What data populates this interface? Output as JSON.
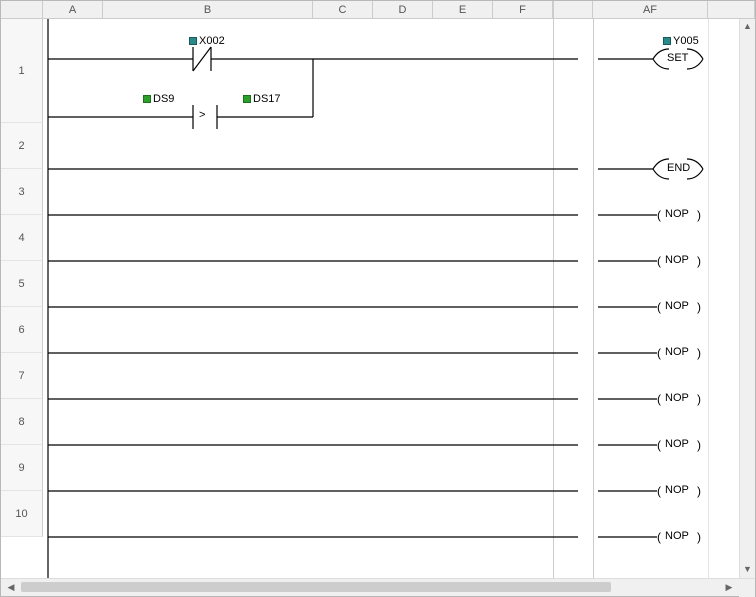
{
  "columns": {
    "A": "A",
    "B": "B",
    "C": "C",
    "D": "D",
    "E": "E",
    "F": "F",
    "AF": "AF"
  },
  "row_labels": [
    "1",
    "2",
    "3",
    "4",
    "5",
    "6",
    "7",
    "8",
    "9",
    "10"
  ],
  "rung1": {
    "contact1": "X002",
    "compare_left": "DS9",
    "compare_op": ">",
    "compare_right": "DS17",
    "output": "Y005",
    "coil": "SET"
  },
  "rung2": {
    "coil": "END"
  },
  "nop_label": "NOP",
  "chart_data": {
    "type": "table",
    "title": "Ladder Logic Program",
    "rungs": [
      {
        "rung": 1,
        "branches": [
          {
            "elements": [
              {
                "type": "contact_nc",
                "address": "X002"
              }
            ]
          },
          {
            "elements": [
              {
                "type": "compare",
                "op": ">",
                "left": "DS9",
                "right": "DS17"
              }
            ]
          }
        ],
        "output": {
          "type": "SET",
          "address": "Y005"
        }
      },
      {
        "rung": 2,
        "branches": [],
        "output": {
          "type": "END"
        }
      },
      {
        "rung": 3,
        "output": {
          "type": "NOP"
        }
      },
      {
        "rung": 4,
        "output": {
          "type": "NOP"
        }
      },
      {
        "rung": 5,
        "output": {
          "type": "NOP"
        }
      },
      {
        "rung": 6,
        "output": {
          "type": "NOP"
        }
      },
      {
        "rung": 7,
        "output": {
          "type": "NOP"
        }
      },
      {
        "rung": 8,
        "output": {
          "type": "NOP"
        }
      },
      {
        "rung": 9,
        "output": {
          "type": "NOP"
        }
      },
      {
        "rung": 10,
        "output": {
          "type": "NOP"
        }
      }
    ]
  }
}
